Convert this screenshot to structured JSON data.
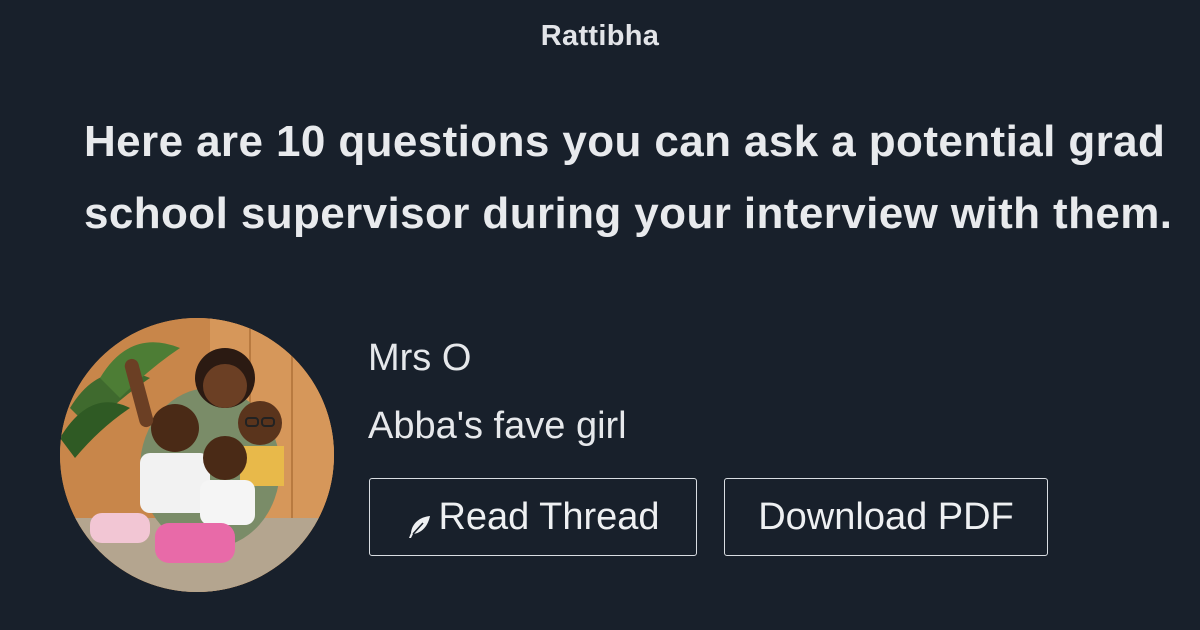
{
  "brand": "Rattibha",
  "title": "Here are 10 questions you can ask a potential grad school supervisor during your interview with them.",
  "author": {
    "name": "Mrs O",
    "bio": "Abba's fave girl"
  },
  "buttons": {
    "read_thread": {
      "label": "Read Thread",
      "icon": "feather-icon"
    },
    "download_pdf": {
      "label": "Download PDF"
    }
  },
  "colors": {
    "background": "#18202b",
    "text": "#e6e8eb",
    "button_border": "#d9dde2"
  }
}
